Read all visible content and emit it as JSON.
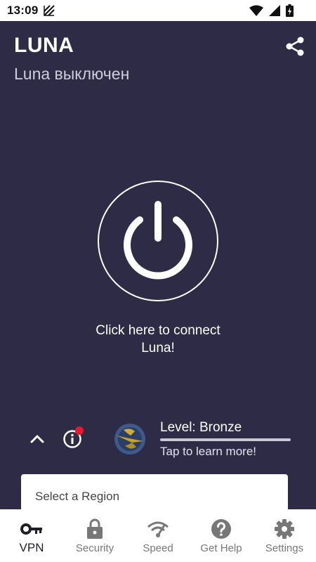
{
  "status_bar": {
    "time": "13:09"
  },
  "header": {
    "title": "LUNA",
    "subtitle": "Luna выключен"
  },
  "power": {
    "connect_text": "Click here to connect Luna!"
  },
  "level": {
    "label": "Level: Bronze",
    "link": "Tap to learn more!",
    "progress": 0
  },
  "region": {
    "label": "Select a Region"
  },
  "nav": {
    "items": [
      {
        "label": "VPN",
        "icon": "key-icon",
        "active": true
      },
      {
        "label": "Security",
        "icon": "lock-icon",
        "active": false
      },
      {
        "label": "Speed",
        "icon": "speed-wifi-icon",
        "active": false
      },
      {
        "label": "Get Help",
        "icon": "help-icon",
        "active": false
      },
      {
        "label": "Settings",
        "icon": "gear-icon",
        "active": false
      }
    ]
  },
  "colors": {
    "background": "#2d2b46",
    "nav_active": "#1f1f2a",
    "nav_inactive": "#777777",
    "notification": "#e8192c"
  }
}
